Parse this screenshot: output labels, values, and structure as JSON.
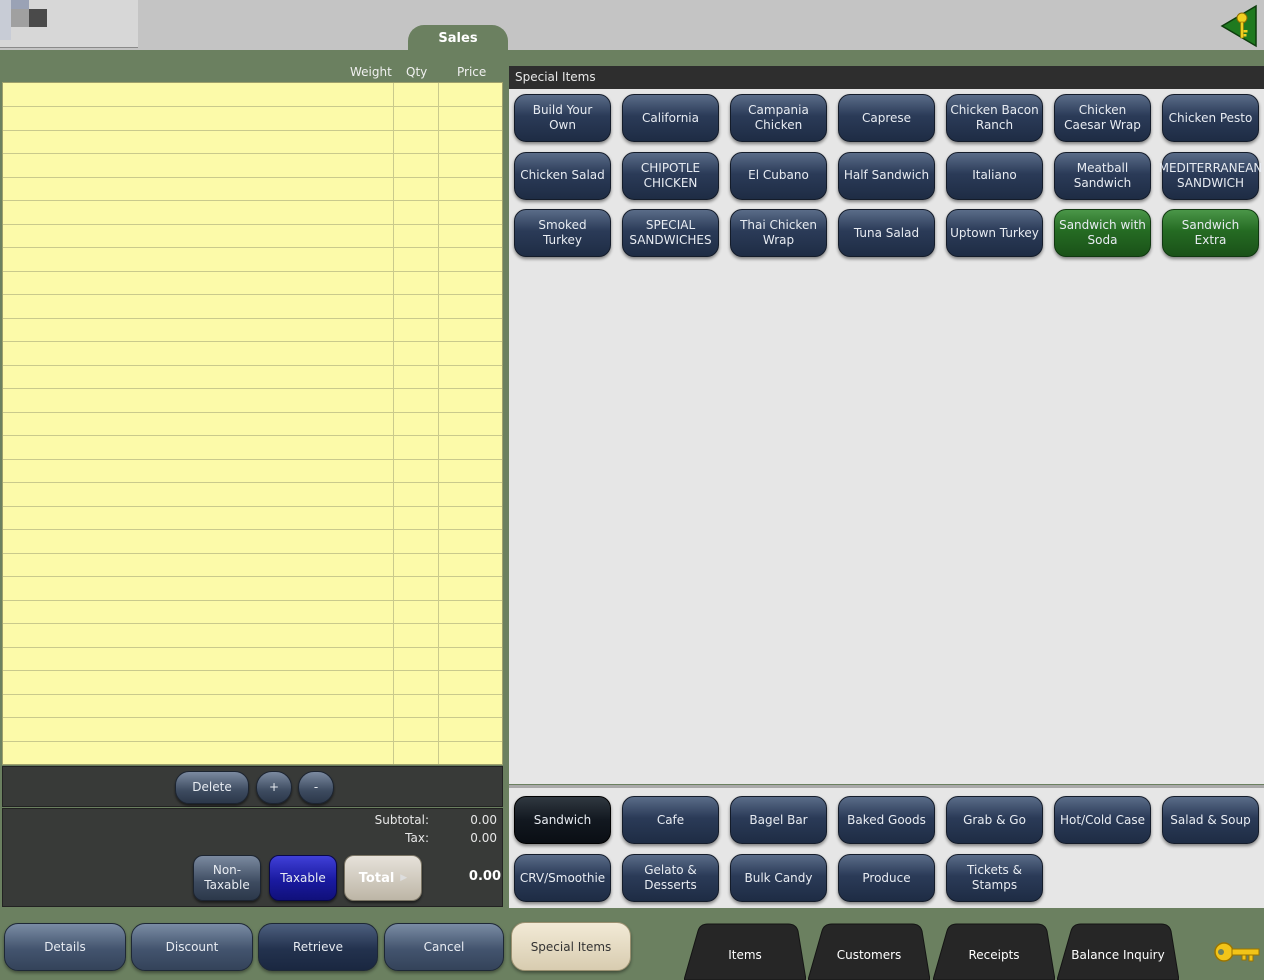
{
  "header": {
    "sales_tab": "Sales"
  },
  "sales": {
    "columns": {
      "weight": "Weight",
      "qty": "Qty",
      "price": "Price"
    },
    "actions": {
      "delete": "Delete",
      "plus": "+",
      "minus": "-"
    },
    "totals": {
      "subtotal_label": "Subtotal:",
      "subtotal_value": "0.00",
      "tax_label": "Tax:",
      "tax_value": "0.00",
      "total_value": "0.00"
    },
    "buttons": {
      "non_taxable": "Non-\nTaxable",
      "taxable": "Taxable",
      "total": "Total"
    }
  },
  "special_items": {
    "title": "Special Items",
    "items": [
      "Build Your Own",
      "California",
      "Campania Chicken",
      "Caprese",
      "Chicken Bacon Ranch",
      "Chicken Caesar Wrap",
      "Chicken Pesto",
      "Chicken Salad",
      "CHIPOTLE CHICKEN",
      "El Cubano",
      "Half Sandwich",
      "Italiano",
      "Meatball Sandwich",
      "MEDITERRANEAN SANDWICH",
      "Smoked Turkey",
      "SPECIAL SANDWICHES",
      "Thai Chicken Wrap",
      "Tuna Salad",
      "Uptown Turkey",
      "Sandwich with Soda",
      "Sandwich Extra"
    ],
    "green_items": [
      19,
      20
    ]
  },
  "categories": {
    "items": [
      "Sandwich",
      "Cafe",
      "Bagel Bar",
      "Baked Goods",
      "Grab & Go",
      "Hot/Cold Case",
      "Salad & Soup",
      "CRV/Smoothie",
      "Gelato & Desserts",
      "Bulk Candy",
      "Produce",
      "Tickets & Stamps"
    ],
    "active_index": 0
  },
  "bottom": {
    "details": "Details",
    "discount": "Discount",
    "retrieve": "Retrieve",
    "cancel": "Cancel",
    "special_items": "Special Items",
    "tabs": [
      "Items",
      "Customers",
      "Receipts",
      "Balance Inquiry"
    ]
  },
  "colors": {
    "background": "#6b8060",
    "ledger": "#fcfaa9",
    "item_button": "#2b3b58",
    "green_button": "#256b23",
    "taxable_button": "#1a1aa0"
  }
}
